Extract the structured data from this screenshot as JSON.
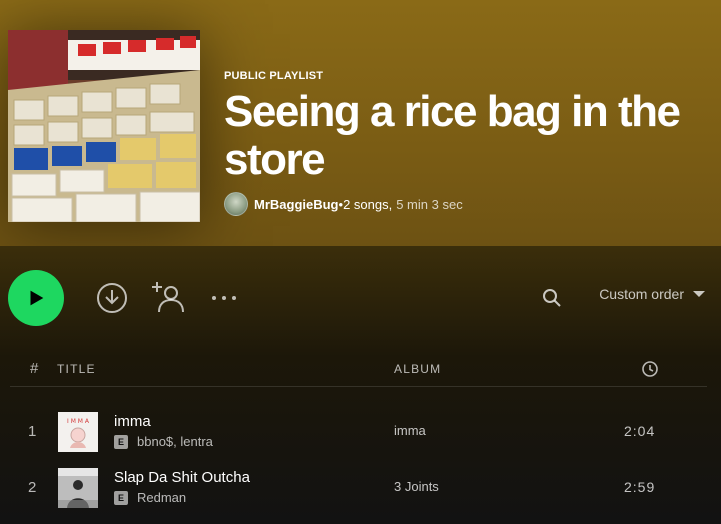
{
  "header": {
    "type_label": "PUBLIC PLAYLIST",
    "title": "Seeing a rice bag in the store",
    "owner": "MrBaggieBug",
    "separator": " • ",
    "song_count": "2 songs,",
    "duration": "5 min 3 sec",
    "cover_icon": "rice-bag-store-photo",
    "avatar_icon": "user-avatar"
  },
  "actions": {
    "play_icon": "play-icon",
    "download_icon": "download-icon",
    "add_user_icon": "add-user-icon",
    "more_icon": "more-options-icon",
    "search_icon": "search-icon",
    "sort_label": "Custom order"
  },
  "table": {
    "headers": {
      "num": "#",
      "title": "TITLE",
      "album": "ALBUM",
      "duration_icon": "clock-icon"
    },
    "rows": [
      {
        "num": "1",
        "title": "imma",
        "explicit": "E",
        "artists": "bbno$, lentra",
        "album": "imma",
        "duration": "2:04"
      },
      {
        "num": "2",
        "title": "Slap Da Shit Outcha",
        "explicit": "E",
        "artists": "Redman",
        "album": "3 Joints",
        "duration": "2:59"
      }
    ]
  },
  "colors": {
    "accent": "#1ed760",
    "hero": "#8a6a17",
    "background": "#121212"
  }
}
